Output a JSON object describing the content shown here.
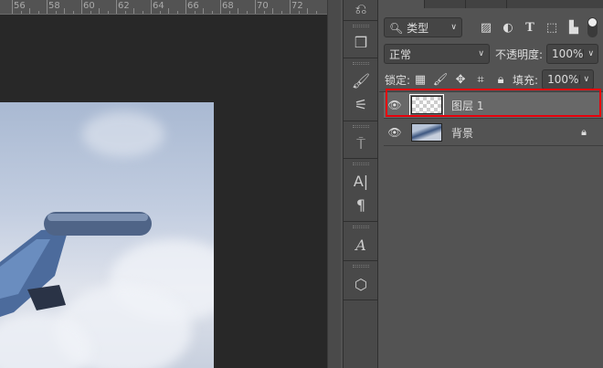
{
  "ruler": {
    "labels": [
      "56",
      "58",
      "60",
      "62",
      "64",
      "66",
      "68",
      "70",
      "72"
    ]
  },
  "layers_panel": {
    "filter_kind": "类型",
    "blend_mode": "正常",
    "opacity_label": "不透明度:",
    "opacity_value": "100%",
    "lock_label": "锁定:",
    "fill_label": "填充:",
    "fill_value": "100%",
    "layers": [
      {
        "name": "图层 1",
        "selected": true,
        "locked": false
      },
      {
        "name": "背景",
        "selected": false,
        "locked": true
      }
    ]
  },
  "colors": {
    "highlight": "#e8000b",
    "selected_row": "#686868"
  }
}
